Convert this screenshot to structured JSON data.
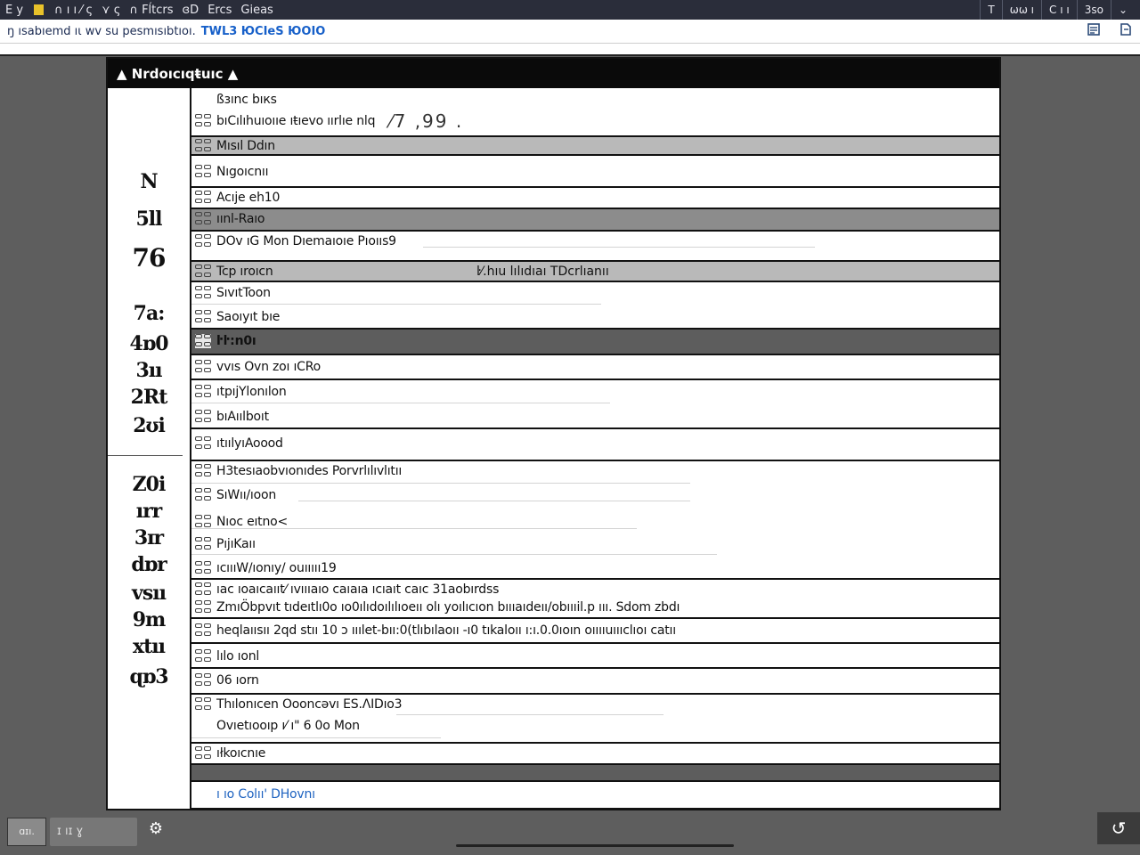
{
  "titlebar": {
    "menu": [
      "E y",
      "∩ ı ı ⁄ ς",
      "⋎ ς",
      "∩ Fĺtcrs",
      "ɞD",
      "Ercs",
      "Gieas"
    ],
    "right": [
      "T",
      "ωω ı",
      "C ı ı",
      "3so",
      "⌄"
    ]
  },
  "addressbar": {
    "text": "ŋ ısabıemd ıɩ wv su pesmısıbtıoı.",
    "highlight": "TWL3 ЮCIeS ЮOIO"
  },
  "panel": {
    "title": "▲ Nrdoıcıqŧuıc ▲"
  },
  "gutter": {
    "numbers": [
      "N",
      "5ll",
      "76",
      "7a:",
      "4ɒ0",
      "3ıı",
      "2Rt",
      "2ʊi",
      "Z0i",
      "ırr",
      "3ɪr",
      "dɒr",
      "vsıı",
      "9m",
      "xtıı",
      "ɋɒ3"
    ]
  },
  "rows": [
    {
      "lines": [
        "ßɜınc bıкs",
        "bıCılıhuıoııe ıŧıevo ıırlıe nlq"
      ],
      "extra": "⁄7 ,99 ."
    },
    {
      "lines": [
        "Mısıl Ddın"
      ]
    },
    {
      "lines": [
        "Nıgoıcnıı"
      ]
    },
    {
      "lines": [
        "Acıje eh10"
      ]
    },
    {
      "lines": [
        "ıınl-Raıo"
      ]
    },
    {
      "lines": [
        "DOv ıG Mon Dıemaıoıe Pıoııs9"
      ]
    },
    {
      "lines": [
        "Tcp ıroıcn"
      ],
      "mid": "ŀ⁄.hıu  lılıdıaı  TDcrlıanıı"
    },
    {
      "lines": [
        "SıvıtToon"
      ]
    },
    {
      "lines": [
        "Saoıyıt bıe"
      ]
    },
    {
      "lines": [
        "ŀŀ:n0ı"
      ]
    },
    {
      "lines": [
        "vvıs Ovn zoı ıCRo"
      ]
    },
    {
      "lines": [
        "ıtpıjYlonılon"
      ]
    },
    {
      "lines": [
        "bıAıılboıt"
      ]
    },
    {
      "lines": [
        "ıtıılyıAoood"
      ]
    },
    {
      "lines": [
        "H3tesıaobvıonıdes Porvrlılıvlıtıı"
      ]
    },
    {
      "lines": [
        "SıWıı/ıoon"
      ]
    },
    {
      "lines": [
        "Nıoc eıtno<"
      ]
    },
    {
      "lines": [
        "PıjıKaıı"
      ]
    },
    {
      "lines": [
        "ıcıııW/ıonıy/ ouııııı19"
      ]
    },
    {
      "lines": [
        "ıac ıoaıcaııt⁄ ıvıııaıo caıaıa ıcıaıt caıc 31aobırdss",
        "ZmıÖbpvıt tıdeıtlı0o ıo0ılıdoılılıoeıı olı yoılıcıon bıııaıdeıı/obıııil.p ııı. Sdom zbdı"
      ]
    },
    {
      "lines": [
        "heqlaıısıı 2qd stıı 10 ɔ ııılet-bıı:0(tlıbılaoıı  -ı0  tıkaloıı ı:ı.0.0ıoın oııııuıııclıoı catıı"
      ]
    },
    {
      "lines": [
        "lılo ıonl"
      ]
    },
    {
      "lines": [
        "06 ıorn"
      ]
    },
    {
      "lines": [
        "Thılonıcen Oooncəvı ES.ɅIDıo3",
        "Ovıetıooıp ı⁄ ı\" 6 0o Mon"
      ]
    },
    {
      "lines": [
        "ıłkoıcnıe"
      ]
    },
    {
      "lines": []
    },
    {
      "lines": [
        "ı ıo Colıı' DHovnı"
      ]
    }
  ],
  "taskbar": {
    "thumb_label": "ɑɪı.",
    "pill_label": "ɪ ıɪ ɣ",
    "icon": "⚙",
    "corner": "↺"
  }
}
